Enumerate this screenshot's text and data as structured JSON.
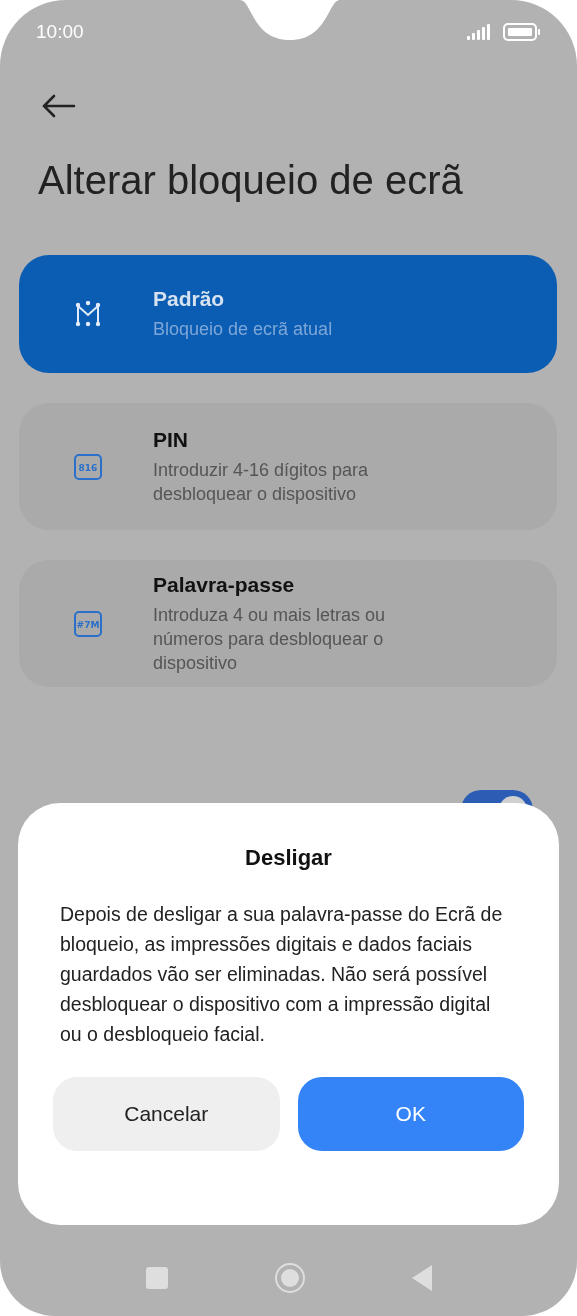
{
  "status_bar": {
    "time": "10:00"
  },
  "title": "Alterar bloqueio de ecrã",
  "options": [
    {
      "kind": "pattern",
      "title": "Padrão",
      "subtitle": "Bloqueio de ecrã atual",
      "selected": true
    },
    {
      "kind": "pin",
      "icon_text": "816",
      "title": "PIN",
      "subtitle": "Introduzir 4-16 dígitos para desbloquear o dispositivo",
      "selected": false
    },
    {
      "kind": "password",
      "icon_text": "#7M",
      "title": "Palavra-passe",
      "subtitle": "Introduza 4 ou mais letras ou números para desbloquear o dispositivo",
      "selected": false
    }
  ],
  "setting_row": {
    "on": true
  },
  "dialog": {
    "title": "Desligar",
    "message": "Depois de desligar a sua palavra-passe do Ecrã de bloqueio, as impressões digitais e dados faciais guardados vão ser eliminadas. Não será possível desbloquear o dispositivo com a impressão digital ou o desbloqueio facial.",
    "buttons": [
      {
        "label": "Cancelar",
        "kind": "secondary"
      },
      {
        "label": "OK",
        "kind": "primary"
      }
    ]
  }
}
